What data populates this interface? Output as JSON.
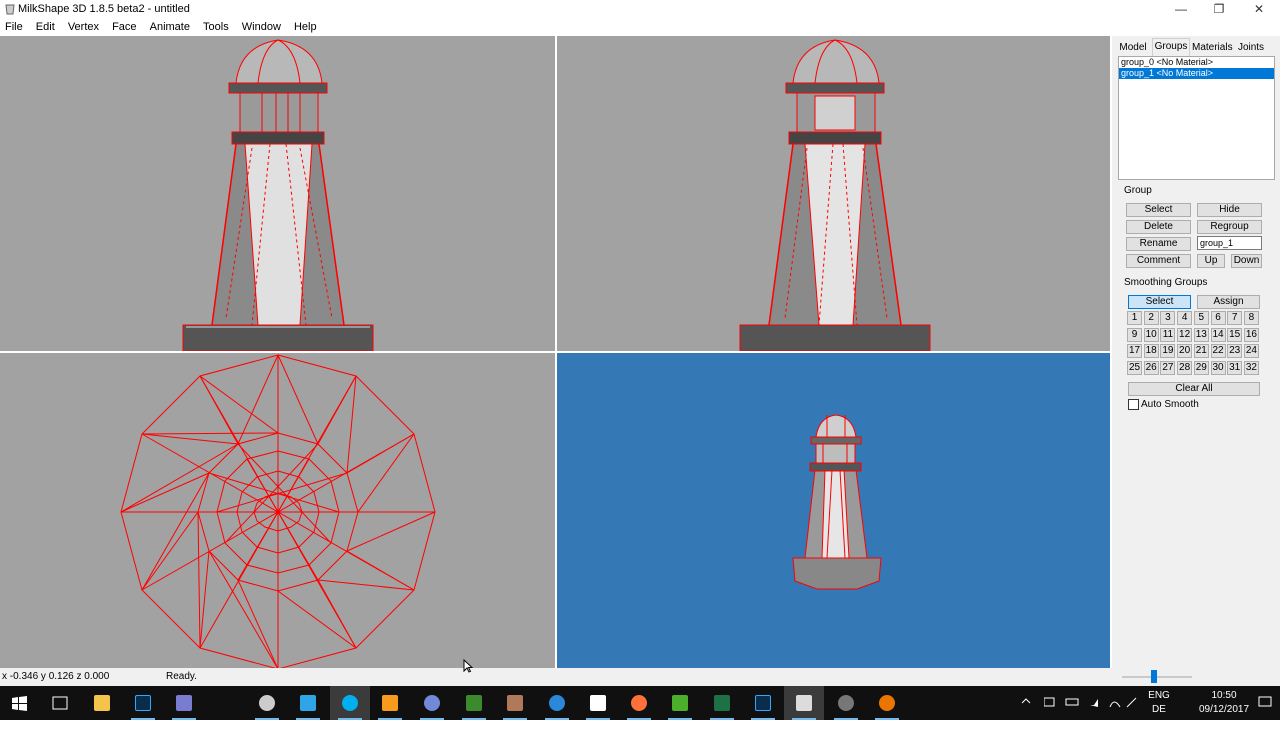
{
  "window": {
    "title": "MilkShape 3D 1.8.5 beta2 - untitled",
    "minimize_glyph": "—",
    "maximize_glyph": "❐",
    "close_glyph": "✕"
  },
  "menu": [
    "File",
    "Edit",
    "Vertex",
    "Face",
    "Animate",
    "Tools",
    "Window",
    "Help"
  ],
  "viewports": {
    "background_color": "#a2a2a2",
    "camera_background_color": "#3479b5",
    "wire_color": "#ff0000"
  },
  "panel": {
    "tabs": [
      "Model",
      "Groups",
      "Materials",
      "Joints"
    ],
    "active_tab": "Groups",
    "groups": [
      {
        "label": "group_0 <No Material>",
        "selected": false
      },
      {
        "label": "group_1 <No Material>",
        "selected": true
      }
    ],
    "group_section": {
      "heading": "Group",
      "select_label": "Select",
      "hide_label": "Hide",
      "delete_label": "Delete",
      "regroup_label": "Regroup",
      "rename_label": "Rename",
      "name_value": "group_1",
      "comment_label": "Comment",
      "up_label": "Up",
      "down_label": "Down"
    },
    "smoothing": {
      "heading": "Smoothing Groups",
      "select_label": "Select",
      "assign_label": "Assign",
      "numbers": [
        "1",
        "2",
        "3",
        "4",
        "5",
        "6",
        "7",
        "8",
        "9",
        "10",
        "11",
        "12",
        "13",
        "14",
        "15",
        "16",
        "17",
        "18",
        "19",
        "20",
        "21",
        "22",
        "23",
        "24",
        "25",
        "26",
        "27",
        "28",
        "29",
        "30",
        "31",
        "32"
      ],
      "clear_all_label": "Clear All",
      "auto_smooth_label": "Auto Smooth",
      "auto_smooth_checked": false
    }
  },
  "status": {
    "coords": "x -0.346 y 0.126 z 0.000",
    "message": "Ready."
  },
  "taskbar": {
    "icons": [
      "windows-start-icon",
      "task-view-icon",
      "file-explorer-icon",
      "photoshop-icon",
      "app-icon",
      "app-icon",
      "app-icon",
      "skype-icon",
      "media-player-icon",
      "discord-icon",
      "app-icon",
      "app-icon",
      "app-icon",
      "file-icon",
      "firefox-icon",
      "app-icon",
      "excel-icon",
      "photoshop-icon",
      "milkshape-icon",
      "app-icon",
      "blender-icon"
    ],
    "language": [
      "ENG",
      "DE"
    ],
    "time": "10:50",
    "date": "09/12/2017"
  }
}
